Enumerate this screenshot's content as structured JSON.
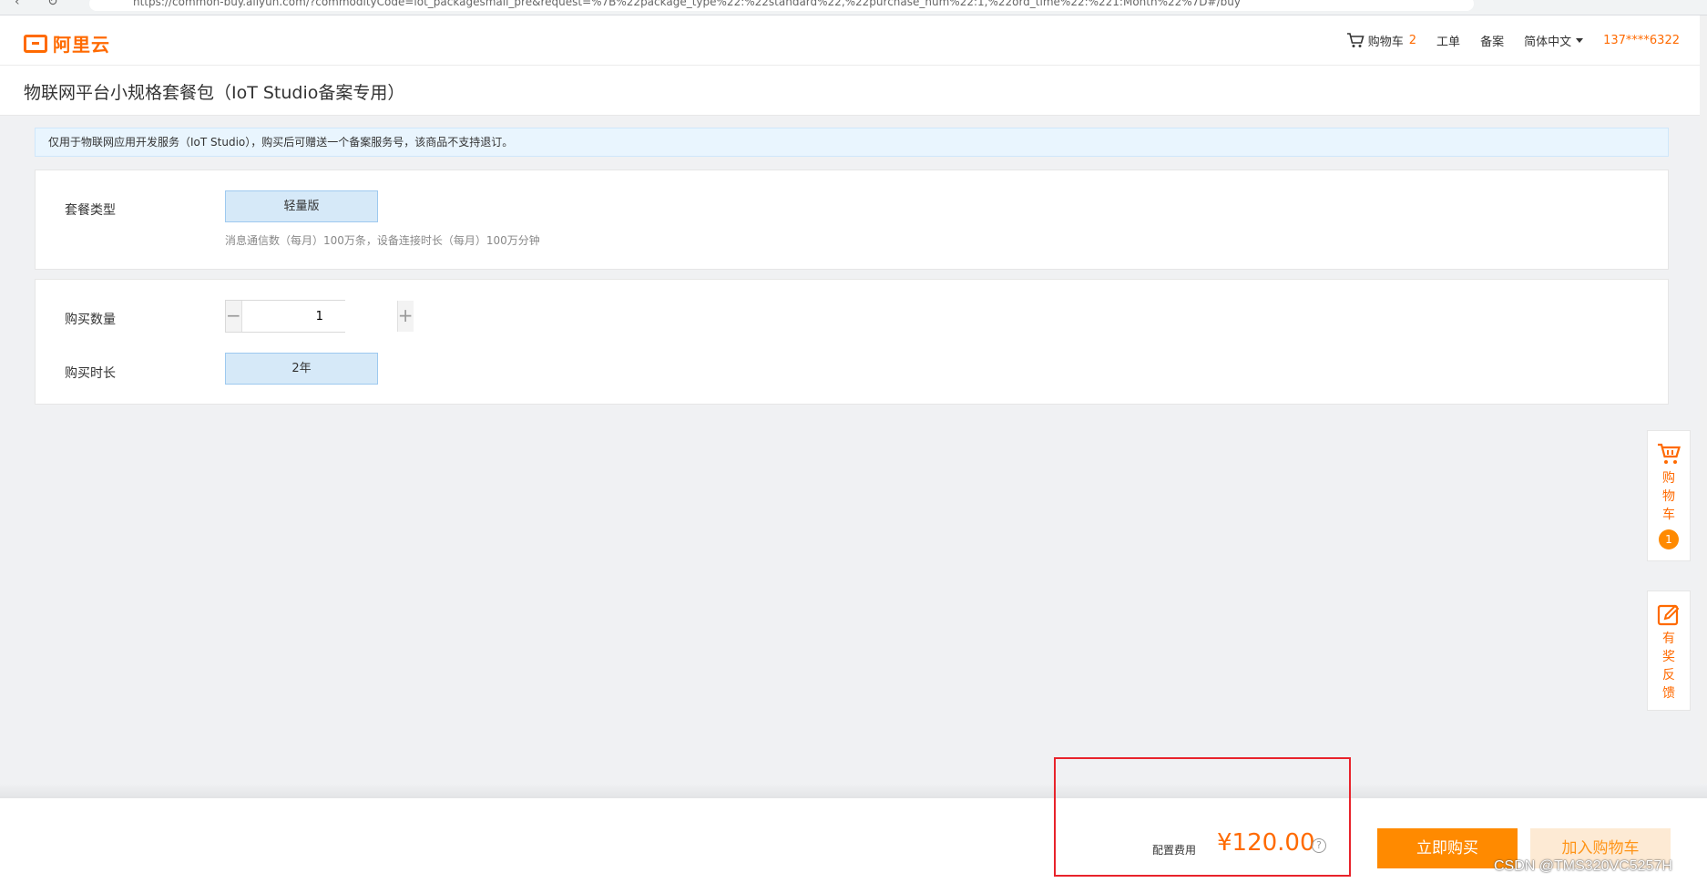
{
  "browser": {
    "url": "https://common-buy.aliyun.com/?commodityCode=iot_packagesmall_pre&request=%7B%22package_type%22:%22standard%22,%22purchase_num%22:1,%22ord_time%22:%221:Month%22%7D#/buy"
  },
  "header": {
    "logo_text": "阿里云",
    "cart_label": "购物车",
    "cart_count": "2",
    "ticket": "工单",
    "filing": "备案",
    "language": "简体中文",
    "user": "137****6322"
  },
  "page": {
    "title": "物联网平台小规格套餐包（IoT Studio备案专用）",
    "notice": "仅用于物联网应用开发服务（IoT Studio），购买后可赠送一个备案服务号，该商品不支持退订。"
  },
  "package": {
    "label": "套餐类型",
    "option": "轻量版",
    "description": "消息通信数（每月）100万条，设备连接时长（每月）100万分钟"
  },
  "purchase": {
    "quantity_label": "购买数量",
    "quantity": "1",
    "minus": "−",
    "plus": "+",
    "duration_label": "购买时长",
    "duration": "2年"
  },
  "side": {
    "cart_text": "购物车",
    "cart_badge": "1",
    "feedback_text": "有奖反馈"
  },
  "footer": {
    "fee_label": "配置费用",
    "fee_value": "¥120.00",
    "help": "?",
    "buy_now": "立即购买",
    "add_cart": "加入购物车"
  },
  "watermark": "CSDN @TMS320VC5257H",
  "colors": {
    "brand": "#ff6a00",
    "buy_button": "#ff8a00",
    "highlight": "#e8232b",
    "option_bg": "#d6e9f8"
  }
}
